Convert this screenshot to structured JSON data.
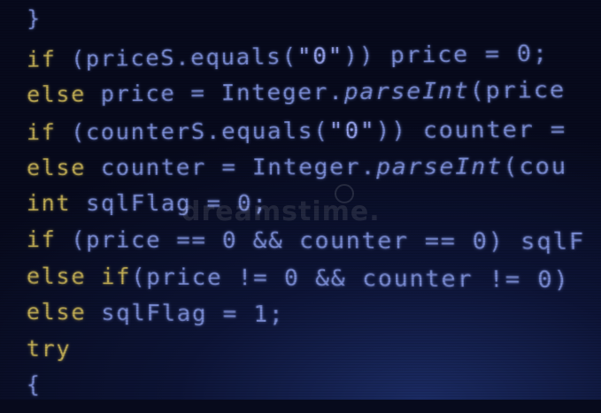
{
  "code_lines": [
    {
      "segments": [
        {
          "text": "}",
          "cls": ""
        }
      ]
    },
    {
      "segments": [
        {
          "text": "if",
          "cls": "kw"
        },
        {
          "text": " (priceS.equals(",
          "cls": ""
        },
        {
          "text": "\"0\"",
          "cls": "str"
        },
        {
          "text": ")) price = 0;",
          "cls": ""
        }
      ]
    },
    {
      "segments": [
        {
          "text": "else",
          "cls": "kw"
        },
        {
          "text": " price = Integer.",
          "cls": ""
        },
        {
          "text": "parseInt",
          "cls": "it"
        },
        {
          "text": "(price",
          "cls": ""
        }
      ]
    },
    {
      "segments": [
        {
          "text": "if",
          "cls": "kw"
        },
        {
          "text": " (counterS.equals(",
          "cls": ""
        },
        {
          "text": "\"0\"",
          "cls": "str"
        },
        {
          "text": ")) counter =",
          "cls": ""
        }
      ]
    },
    {
      "segments": [
        {
          "text": "else",
          "cls": "kw"
        },
        {
          "text": " counter = Integer.",
          "cls": ""
        },
        {
          "text": "parseInt",
          "cls": "it"
        },
        {
          "text": "(cou",
          "cls": ""
        }
      ]
    },
    {
      "segments": [
        {
          "text": "int",
          "cls": "kw"
        },
        {
          "text": " sqlFlag = 0;",
          "cls": ""
        }
      ]
    },
    {
      "segments": [
        {
          "text": "if",
          "cls": "kw"
        },
        {
          "text": " (price == 0 && counter == 0) sqlF",
          "cls": ""
        }
      ]
    },
    {
      "segments": [
        {
          "text": "else if",
          "cls": "kw"
        },
        {
          "text": "(price != 0 && counter != 0)",
          "cls": ""
        }
      ]
    },
    {
      "segments": [
        {
          "text": "else",
          "cls": "kw"
        },
        {
          "text": " sqlFlag = 1;",
          "cls": ""
        }
      ]
    },
    {
      "segments": [
        {
          "text": "try",
          "cls": "kw"
        }
      ]
    },
    {
      "segments": [
        {
          "text": "{",
          "cls": ""
        }
      ]
    }
  ],
  "watermark": {
    "text": "dreamstime."
  },
  "colors": {
    "keyword": "#c2ae55",
    "code": "#7c8ed6",
    "background": "#0d1436"
  }
}
